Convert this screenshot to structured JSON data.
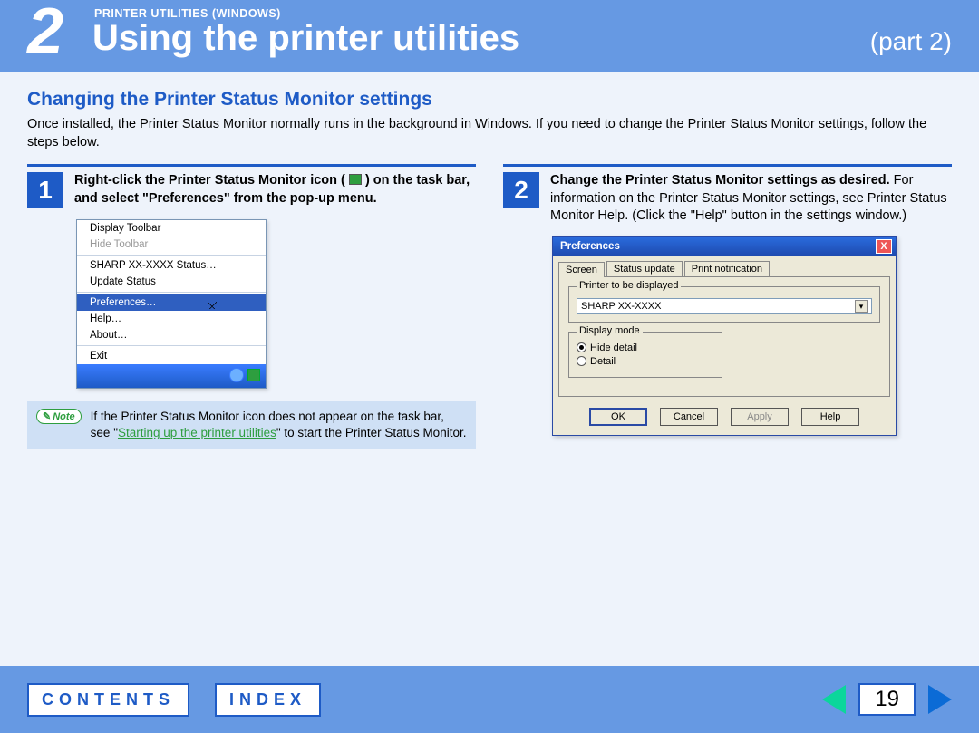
{
  "header": {
    "chapter_number": "2",
    "breadcrumb": "PRINTER UTILITIES (WINDOWS)",
    "title": "Using the printer utilities",
    "part": "(part 2)"
  },
  "subheading": "Changing the Printer Status Monitor settings",
  "intro": "Once installed, the Printer Status Monitor normally runs in the background in Windows. If you need to change the Printer Status Monitor settings, follow the steps below.",
  "step1": {
    "number": "1",
    "text_before": "Right-click the Printer Status Monitor icon (",
    "text_after": ") on the task bar, and select \"Preferences\" from the pop-up menu.",
    "menu": {
      "display_toolbar": "Display Toolbar",
      "hide_toolbar": "Hide Toolbar",
      "status": "SHARP XX-XXXX Status…",
      "update_status": "Update Status",
      "preferences": "Preferences…",
      "help": "Help…",
      "about": "About…",
      "exit": "Exit"
    }
  },
  "note": {
    "badge": "Note",
    "text_before": "If the Printer Status Monitor icon does not appear on the task bar, see \"",
    "link": "Starting up the printer utilities",
    "text_after": "\" to start the Printer Status Monitor."
  },
  "step2": {
    "number": "2",
    "bold": "Change the Printer Status Monitor settings as desired.",
    "text": " For information on the Printer Status Monitor settings, see Printer Status Monitor Help. (Click the \"Help\" button in the settings window.)"
  },
  "prefs": {
    "title": "Preferences",
    "close": "X",
    "tabs": {
      "screen": "Screen",
      "status_update": "Status update",
      "print_notification": "Print notification"
    },
    "printer_legend": "Printer to be displayed",
    "printer_value": "SHARP XX-XXXX",
    "display_legend": "Display mode",
    "hide_detail": "Hide detail",
    "detail": "Detail",
    "ok": "OK",
    "cancel": "Cancel",
    "apply": "Apply",
    "help": "Help"
  },
  "footer": {
    "contents": "CONTENTS",
    "index": "INDEX",
    "page": "19"
  }
}
